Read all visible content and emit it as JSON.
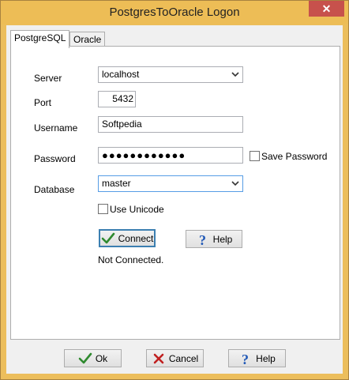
{
  "window": {
    "title": "PostgresToOracle Logon",
    "close_label": "✕"
  },
  "tabs": [
    {
      "label": "PostgreSQL"
    },
    {
      "label": "Oracle"
    }
  ],
  "form": {
    "server_label": "Server",
    "server_value": "localhost",
    "port_label": "Port",
    "port_value": "5432",
    "username_label": "Username",
    "username_value": "Softpedia",
    "password_label": "Password",
    "password_value": "●●●●●●●●●●●●",
    "save_password_label": "Save Password",
    "save_password_checked": false,
    "database_label": "Database",
    "database_value": "master",
    "use_unicode_label": "Use Unicode",
    "use_unicode_checked": false
  },
  "actions": {
    "connect_label": "Connect",
    "help_label": "Help",
    "status_text": "Not Connected."
  },
  "footer": {
    "ok_label": "Ok",
    "cancel_label": "Cancel",
    "help_label": "Help"
  },
  "colors": {
    "titlebar": "#edbd56",
    "close": "#c7514c",
    "check": "#2f8a2f",
    "cross": "#c02020",
    "help": "#1f57b6"
  }
}
